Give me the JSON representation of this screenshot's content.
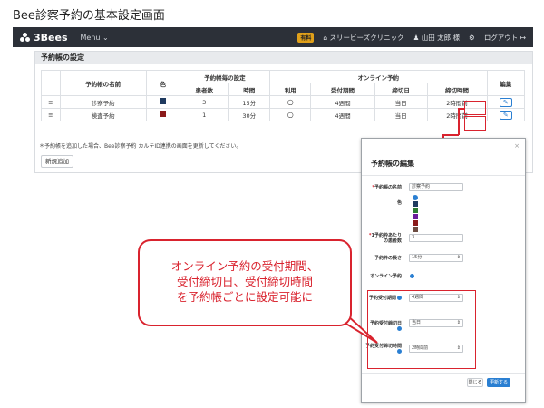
{
  "page_title": "Bee診察予約の基本設定画面",
  "nav": {
    "brand": "3Bees",
    "menu": "Menu",
    "badge": "有料",
    "clinic": "スリービーズクリニック",
    "user": "山田 太郎 様",
    "settings": "⚙",
    "logout": "ログアウト"
  },
  "panel": {
    "title": "予約帳の設定",
    "headers": {
      "name": "予約帳の名前",
      "color": "色",
      "group_setting": "予約帳毎の設定",
      "group_online": "オンライン予約",
      "patients": "患者数",
      "time": "時間",
      "use": "利用",
      "period": "受付期間",
      "deadline_day": "締切日",
      "deadline_time": "締切時間",
      "edit": "編集"
    },
    "rows": [
      {
        "name": "診察予約",
        "color": "#1f3a5f",
        "patients": "3",
        "time": "15分",
        "use": "○",
        "period": "4週間",
        "deadline_day": "当日",
        "deadline_time": "2時間前"
      },
      {
        "name": "検査予約",
        "color": "#8b1a1a",
        "patients": "1",
        "time": "30分",
        "use": "○",
        "period": "4週間",
        "deadline_day": "当日",
        "deadline_time": "2時間前"
      }
    ],
    "note": "＊予約帳を追加した場合、Bee診察予約 カルテID連携の画面を更新してください。",
    "new_button": "新規追加"
  },
  "modal": {
    "title": "予約帳の編集",
    "close": "×",
    "fields": {
      "name_label": "予約帳の名前",
      "name_value": "診察予約",
      "color_label": "色",
      "capacity_label": "1予約枠あたりの患者数",
      "capacity_value": "3",
      "slot_label": "予約枠の長さ",
      "slot_value": "15分",
      "online_label": "オンライン予約",
      "period_label": "予約受付期間",
      "period_value": "4週間",
      "deadline_day_label": "予約受付締切日",
      "deadline_day_value": "当日",
      "deadline_time_label": "予約受付締切時間",
      "deadline_time_value": "2時間前"
    },
    "colors": [
      "#2a7fd2",
      "#1f3a5f",
      "#2e7d32",
      "#6a1b9a",
      "#8b1a1a",
      "#6d4c41"
    ],
    "close_button": "閉じる",
    "update_button": "更新する"
  },
  "callout": {
    "line1": "オンライン予約の受付期間、",
    "line2": "受付締切日、受付締切時間",
    "line3": "を予約帳ごとに設定可能に"
  }
}
